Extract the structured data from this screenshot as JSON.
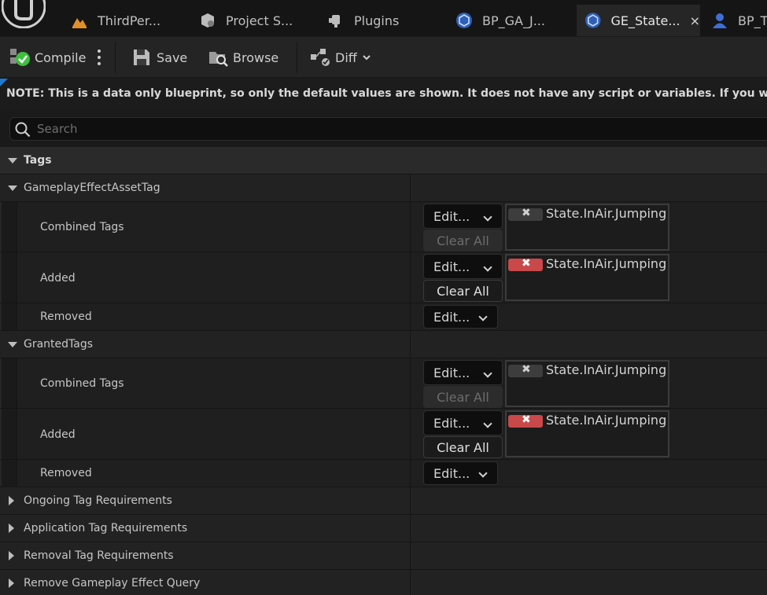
{
  "tabs": [
    {
      "label": "ThirdPer...",
      "icon": "level-map-icon",
      "active": false
    },
    {
      "label": "Project S...",
      "icon": "project-settings-icon",
      "active": false
    },
    {
      "label": "Plugins",
      "icon": "plugin-icon",
      "active": false
    },
    {
      "label": "BP_GA_J...",
      "icon": "blueprint-icon",
      "active": false
    },
    {
      "label": "GE_State...",
      "icon": "blueprint-icon",
      "active": true,
      "close": "×"
    },
    {
      "label": "BP_T",
      "icon": "character-icon",
      "active": false
    }
  ],
  "toolbar": {
    "compile": "Compile",
    "save": "Save",
    "browse": "Browse",
    "diff": "Diff"
  },
  "notice": "NOTE: This is a data only blueprint, so only the default values are shown.  It does not have any script or variables.  If you want",
  "search": {
    "placeholder": "Search",
    "value": ""
  },
  "categories": {
    "tags": "Tags",
    "ongoing": "Ongoing Tag Requirements",
    "application": "Application Tag Requirements",
    "removal": "Removal Tag Requirements",
    "remove_query": "Remove Gameplay Effect Query"
  },
  "groups": [
    {
      "title": "GameplayEffectAssetTag",
      "combined_label": "Combined Tags",
      "added_label": "Added",
      "removed_label": "Removed",
      "combined_tag": "State.InAir.Jumping",
      "added_tag": "State.InAir.Jumping"
    },
    {
      "title": "GrantedTags",
      "combined_label": "Combined Tags",
      "added_label": "Added",
      "removed_label": "Removed",
      "combined_tag": "State.InAir.Jumping",
      "added_tag": "State.InAir.Jumping"
    }
  ],
  "buttons": {
    "edit": "Edit...",
    "clear_all": "Clear All",
    "remove_glyph": "✖"
  },
  "colors": {
    "accent_blue": "#1e7ad0",
    "remove_red": "#c9484a",
    "compile_green": "#3fbf3f"
  }
}
